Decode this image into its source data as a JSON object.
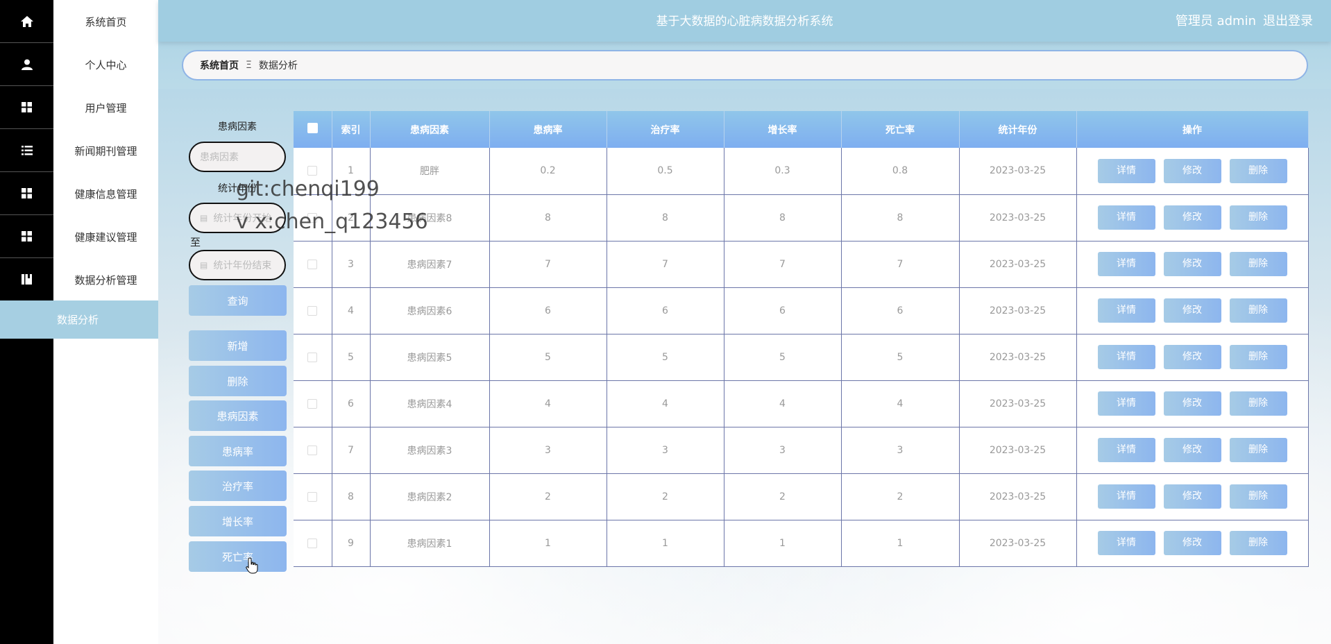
{
  "header": {
    "title": "基于大数据的心脏病数据分析系统",
    "user_label": "管理员 admin",
    "logout_label": "退出登录"
  },
  "sidebar": {
    "items": [
      {
        "label": "系统首页",
        "icon": "home-icon"
      },
      {
        "label": "个人中心",
        "icon": "user-icon"
      },
      {
        "label": "用户管理",
        "icon": "grid-icon"
      },
      {
        "label": "新闻期刊管理",
        "icon": "list-icon"
      },
      {
        "label": "健康信息管理",
        "icon": "grid-icon"
      },
      {
        "label": "健康建议管理",
        "icon": "grid-icon"
      },
      {
        "label": "数据分析管理",
        "icon": "book-icon"
      }
    ],
    "active_sub": "数据分析"
  },
  "breadcrumb": {
    "home": "系统首页",
    "separator": "Ξ",
    "current": "数据分析"
  },
  "search": {
    "factor_label": "患病因素",
    "factor_placeholder": "患病因素",
    "year_label": "统计年份",
    "year_start_placeholder": "统计年份开始",
    "to_label": "至",
    "year_end_placeholder": "统计年份结束",
    "query_button": "查询"
  },
  "actions": {
    "add": "新增",
    "delete": "删除",
    "chart_factor": "患病因素",
    "chart_rate": "患病率",
    "chart_treat": "治疗率",
    "chart_growth": "增长率",
    "chart_death": "死亡率"
  },
  "table": {
    "columns": [
      "索引",
      "患病因素",
      "患病率",
      "治疗率",
      "增长率",
      "死亡率",
      "统计年份",
      "操作"
    ],
    "rows": [
      {
        "index": "1",
        "factor": "肥胖",
        "rate": "0.2",
        "treat": "0.5",
        "growth": "0.3",
        "death": "0.8",
        "year": "2023-03-25"
      },
      {
        "index": "2",
        "factor": "患病因素8",
        "rate": "8",
        "treat": "8",
        "growth": "8",
        "death": "8",
        "year": "2023-03-25"
      },
      {
        "index": "3",
        "factor": "患病因素7",
        "rate": "7",
        "treat": "7",
        "growth": "7",
        "death": "7",
        "year": "2023-03-25"
      },
      {
        "index": "4",
        "factor": "患病因素6",
        "rate": "6",
        "treat": "6",
        "growth": "6",
        "death": "6",
        "year": "2023-03-25"
      },
      {
        "index": "5",
        "factor": "患病因素5",
        "rate": "5",
        "treat": "5",
        "growth": "5",
        "death": "5",
        "year": "2023-03-25"
      },
      {
        "index": "6",
        "factor": "患病因素4",
        "rate": "4",
        "treat": "4",
        "growth": "4",
        "death": "4",
        "year": "2023-03-25"
      },
      {
        "index": "7",
        "factor": "患病因素3",
        "rate": "3",
        "treat": "3",
        "growth": "3",
        "death": "3",
        "year": "2023-03-25"
      },
      {
        "index": "8",
        "factor": "患病因素2",
        "rate": "2",
        "treat": "2",
        "growth": "2",
        "death": "2",
        "year": "2023-03-25"
      },
      {
        "index": "9",
        "factor": "患病因素1",
        "rate": "1",
        "treat": "1",
        "growth": "1",
        "death": "1",
        "year": "2023-03-25"
      }
    ],
    "row_actions": {
      "detail": "详情",
      "edit": "修改",
      "delete": "删除"
    }
  },
  "watermark": {
    "line1": "git:chenqi199",
    "line2": "v x:chen_q123456"
  },
  "colors": {
    "header_bg": "#a0cde1",
    "button_gradient_start": "#a6cbe6",
    "button_gradient_end": "#8db6ee",
    "rail_bg": "#000000"
  }
}
